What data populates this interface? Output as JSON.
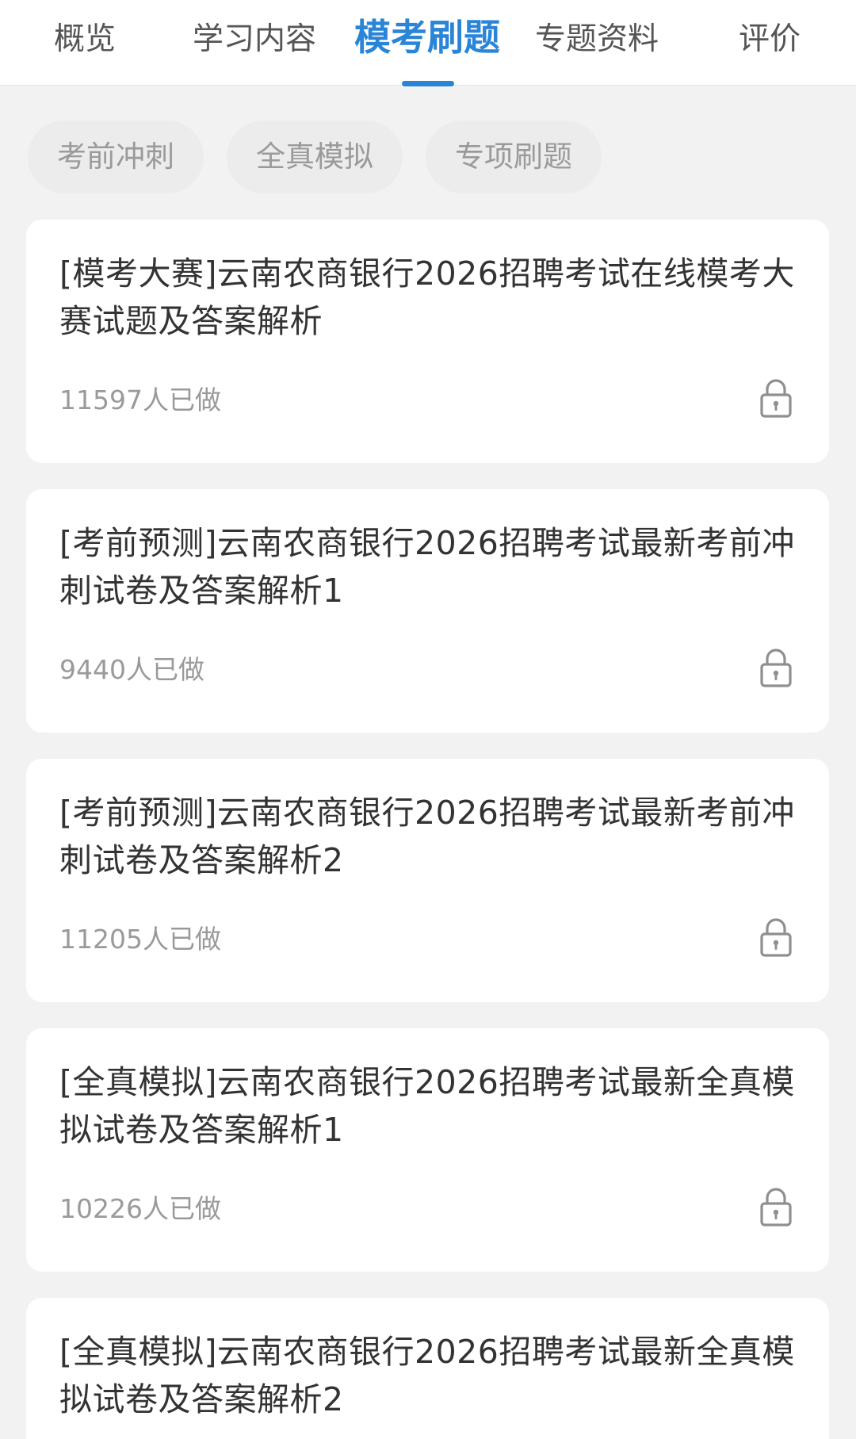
{
  "tabs": [
    {
      "label": "概览"
    },
    {
      "label": "学习内容"
    },
    {
      "label": "模考刷题"
    },
    {
      "label": "专题资料"
    },
    {
      "label": "评价"
    }
  ],
  "active_tab": "模考刷题",
  "filters": [
    {
      "label": "考前冲刺"
    },
    {
      "label": "全真模拟"
    },
    {
      "label": "专项刷题"
    }
  ],
  "cards": [
    {
      "title": "[模考大赛]云南农商银行2026招聘考试在线模考大赛试题及答案解析",
      "count": "11597人已做",
      "icon": "lock-icon"
    },
    {
      "title": "[考前预测]云南农商银行2026招聘考试最新考前冲刺试卷及答案解析1",
      "count": "9440人已做",
      "icon": "lock-icon"
    },
    {
      "title": "[考前预测]云南农商银行2026招聘考试最新考前冲刺试卷及答案解析2",
      "count": "11205人已做",
      "icon": "lock-icon"
    },
    {
      "title": "[全真模拟]云南农商银行2026招聘考试最新全真模拟试卷及答案解析1",
      "count": "10226人已做",
      "icon": "lock-icon"
    },
    {
      "title": "[全真模拟]云南农商银行2026招聘考试最新全真模拟试卷及答案解析2",
      "count": "",
      "icon": ""
    }
  ],
  "colors": {
    "accent": "#2a85d6",
    "background": "#f2f2f2",
    "card": "#ffffff",
    "muted_text": "#9a9a9a"
  }
}
